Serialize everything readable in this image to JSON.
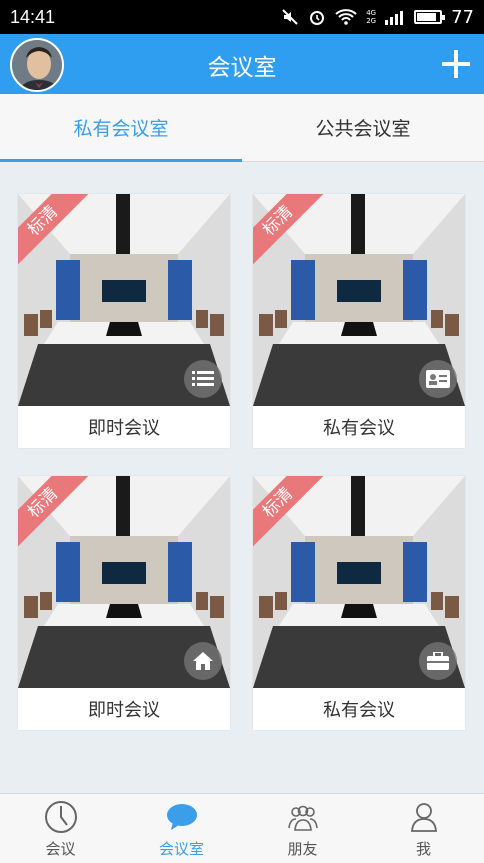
{
  "status": {
    "time": "14:41",
    "battery": "77",
    "network_top": "4G",
    "network_bottom": "2G"
  },
  "header": {
    "title": "会议室"
  },
  "tabs": [
    {
      "label": "私有会议室",
      "active": true
    },
    {
      "label": "公共会议室",
      "active": false
    }
  ],
  "cards": [
    {
      "badge": "标清",
      "label": "即时会议",
      "icon": "list-icon"
    },
    {
      "badge": "标清",
      "label": "私有会议",
      "icon": "id-card-icon"
    },
    {
      "badge": "标清",
      "label": "即时会议",
      "icon": "home-icon"
    },
    {
      "badge": "标清",
      "label": "私有会议",
      "icon": "briefcase-icon"
    }
  ],
  "nav": [
    {
      "label": "会议",
      "icon": "clock-icon",
      "active": false
    },
    {
      "label": "会议室",
      "icon": "chat-bubble-icon",
      "active": true
    },
    {
      "label": "朋友",
      "icon": "friends-icon",
      "active": false
    },
    {
      "label": "我",
      "icon": "person-icon",
      "active": false
    }
  ],
  "colors": {
    "accent": "#2f9ef0",
    "badge": "#e9787a"
  }
}
